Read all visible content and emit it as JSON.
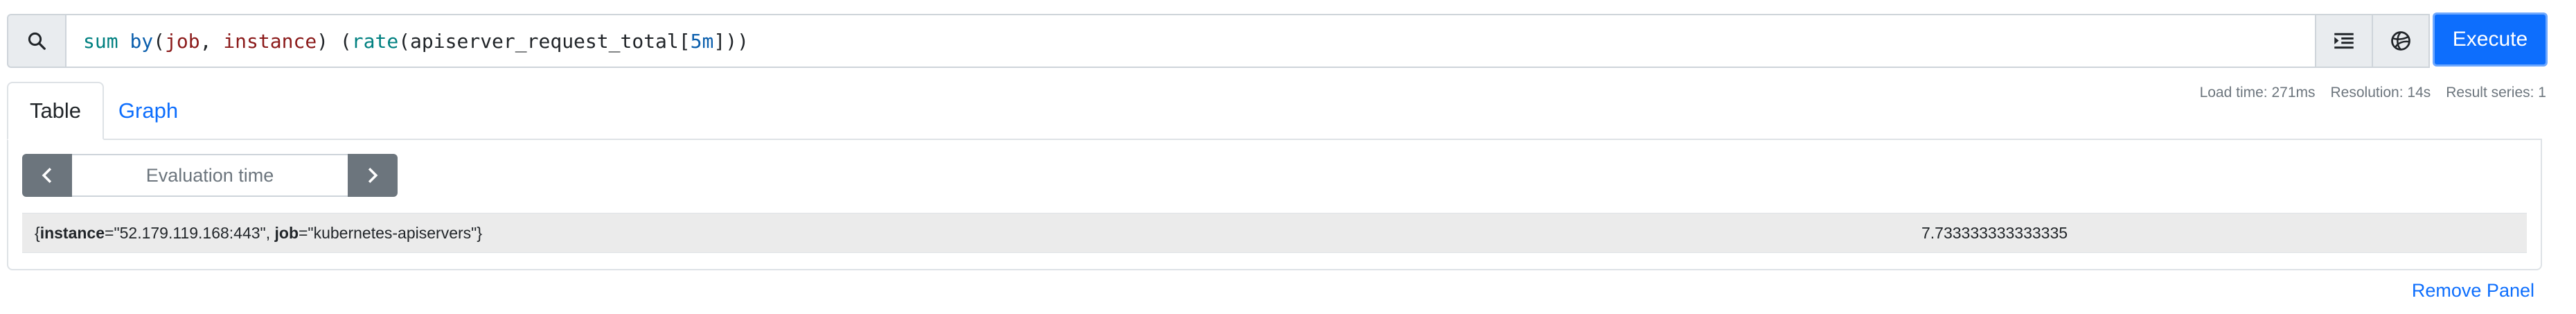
{
  "query": {
    "tokens": [
      {
        "text": "sum",
        "cls": "tok-fn"
      },
      {
        "text": " ",
        "cls": "tok-paren"
      },
      {
        "text": "by",
        "cls": "tok-kw"
      },
      {
        "text": "(",
        "cls": "tok-paren"
      },
      {
        "text": "job",
        "cls": "tok-label"
      },
      {
        "text": ", ",
        "cls": "tok-paren"
      },
      {
        "text": "instance",
        "cls": "tok-label"
      },
      {
        "text": ") (",
        "cls": "tok-paren"
      },
      {
        "text": "rate",
        "cls": "tok-fn"
      },
      {
        "text": "(",
        "cls": "tok-paren"
      },
      {
        "text": "apiserver_request_total",
        "cls": "tok-metric"
      },
      {
        "text": "[",
        "cls": "tok-paren"
      },
      {
        "text": "5m",
        "cls": "tok-num"
      },
      {
        "text": "]))",
        "cls": "tok-paren"
      }
    ],
    "icons": {
      "search": "search-icon",
      "format": "format-query-icon",
      "metrics": "metrics-explorer-icon"
    }
  },
  "execute_label": "Execute",
  "stats": {
    "load_time": "Load time: 271ms",
    "resolution": "Resolution: 14s",
    "result_series": "Result series: 1"
  },
  "tabs": {
    "table": "Table",
    "graph": "Graph"
  },
  "evaluation": {
    "placeholder": "Evaluation time"
  },
  "results": [
    {
      "series_open": "{",
      "label1_name": "instance",
      "label1_value": "=\"52.179.119.168:443\", ",
      "label2_name": "job",
      "label2_value": "=\"kubernetes-apiservers\"}",
      "value": "7.733333333333335"
    }
  ],
  "remove_panel": "Remove Panel",
  "colors": {
    "accent": "#0d6efd",
    "nav_button": "#6c757d"
  }
}
